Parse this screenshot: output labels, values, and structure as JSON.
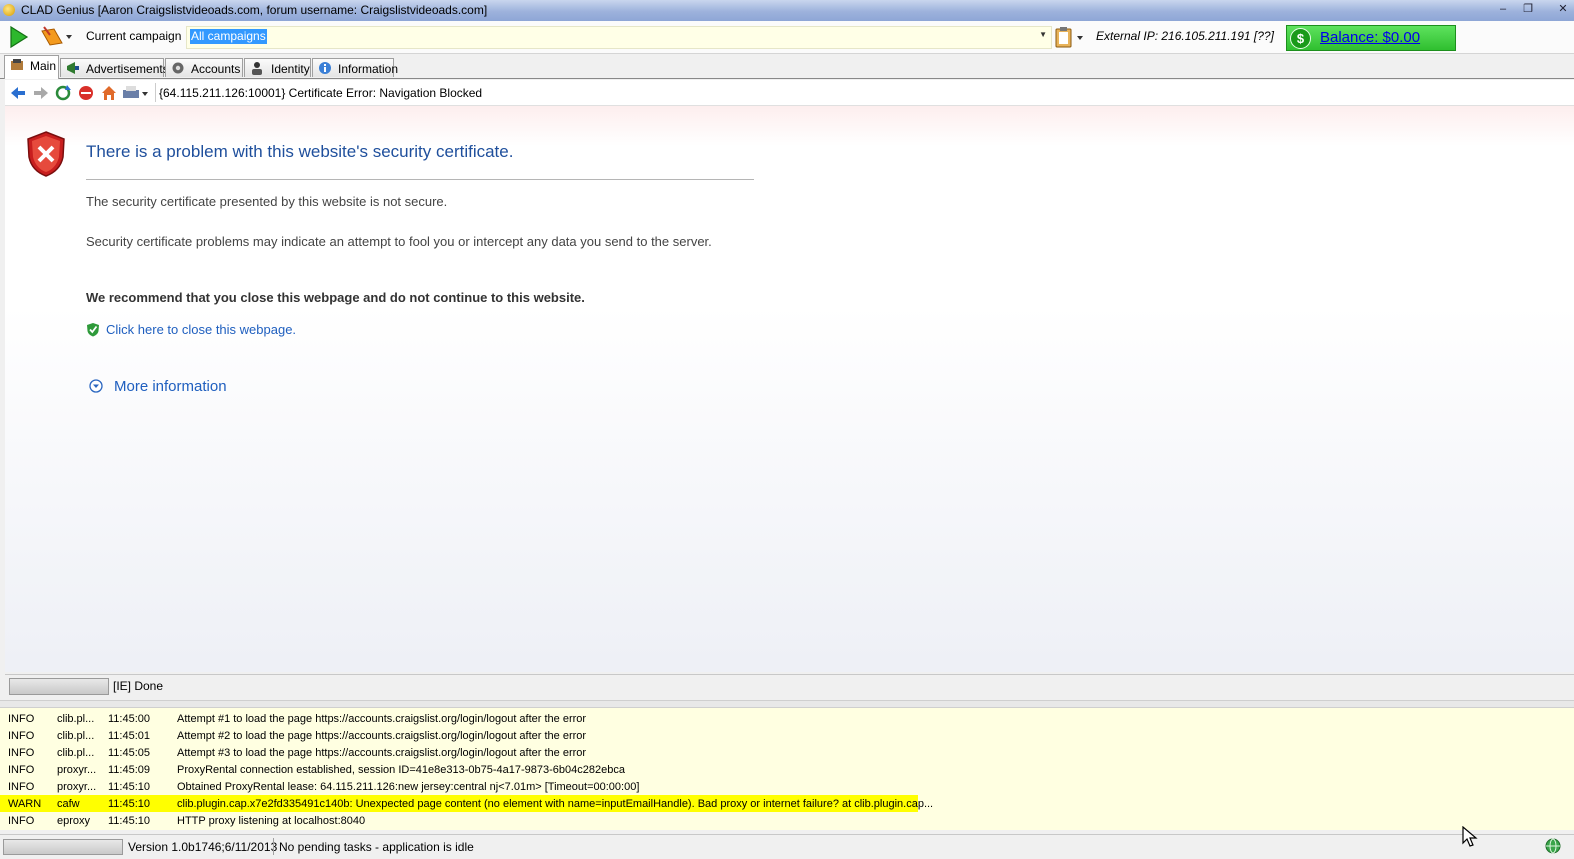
{
  "window": {
    "title": "CLAD Genius [Aaron Craigslistvideoads.com, forum username: Craigslistvideoads.com]",
    "minimize": "‒",
    "maximize": "❐",
    "close": "✕"
  },
  "toolbar": {
    "campaign_label": "Current campaign",
    "campaign_value": "All campaigns",
    "external_ip": "External IP: 216.105.211.191 [??]",
    "balance": "Balance: $0.00",
    "balance_symbol": "$"
  },
  "tabs": [
    {
      "label": "Main"
    },
    {
      "label": "Advertisements"
    },
    {
      "label": "Accounts"
    },
    {
      "label": "Identity"
    },
    {
      "label": "Information"
    }
  ],
  "nav": {
    "url": "{64.115.211.126:10001} Certificate Error: Navigation Blocked"
  },
  "page": {
    "title": "There is a problem with this website's security certificate.",
    "p1": "The security certificate presented by this website is not secure.",
    "p2": "Security certificate problems may indicate an attempt to fool you or intercept any data you send to the server.",
    "p3": "We recommend that you close this webpage and do not continue to this website.",
    "close_link": "Click here to close this webpage.",
    "more_info": "More information"
  },
  "ie_status": "[IE] Done",
  "log": [
    {
      "level": "INFO",
      "source": "clib.pl...",
      "time": "11:45:00",
      "message": "Attempt #1 to load the page https://accounts.craigslist.org/login/logout after the error"
    },
    {
      "level": "INFO",
      "source": "clib.pl...",
      "time": "11:45:01",
      "message": "Attempt #2 to load the page https://accounts.craigslist.org/login/logout after the error"
    },
    {
      "level": "INFO",
      "source": "clib.pl...",
      "time": "11:45:05",
      "message": "Attempt #3 to load the page https://accounts.craigslist.org/login/logout after the error"
    },
    {
      "level": "INFO",
      "source": "proxyr...",
      "time": "11:45:09",
      "message": "ProxyRental connection established, session ID=41e8e313-0b75-4a17-9873-6b04c282ebca"
    },
    {
      "level": "INFO",
      "source": "proxyr...",
      "time": "11:45:10",
      "message": "Obtained ProxyRental lease: 64.115.211.126:new jersey:central nj<7.01m> [Timeout=00:00:00]"
    },
    {
      "level": "WARN",
      "source": "cafw",
      "time": "11:45:10",
      "message": "clib.plugin.cap.x7e2fd335491c140b: Unexpected page content (no element with name=inputEmailHandle). Bad proxy or internet failure?   at clib.plugin.cap..."
    },
    {
      "level": "INFO",
      "source": "eproxy",
      "time": "11:45:10",
      "message": "HTTP proxy listening at localhost:8040"
    }
  ],
  "status": {
    "version": "Version 1.0b1746;6/11/2013",
    "tasks": "No pending tasks - application is idle"
  },
  "colors": {
    "balance_bg": "#3cc83c",
    "warn_row": "#ffff00",
    "log_bg": "#ffffe1",
    "link": "#1f5fbf",
    "title_blue": "#1f4f9c"
  }
}
